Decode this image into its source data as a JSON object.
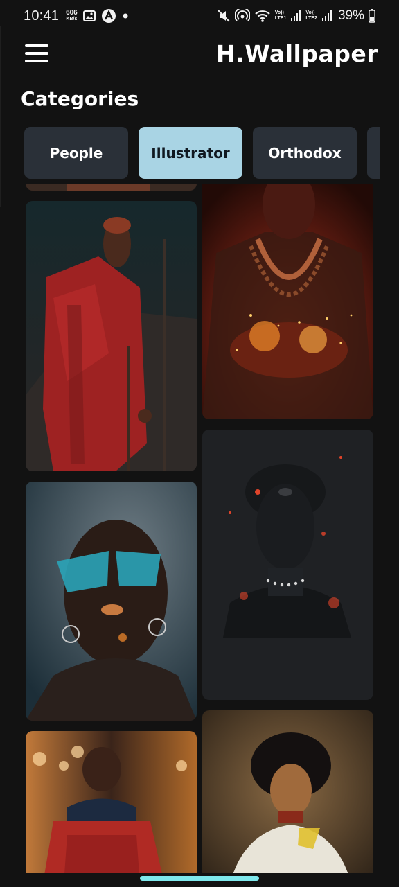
{
  "status_bar": {
    "time": "10:41",
    "net_speed_value": "606",
    "net_speed_unit": "KB/s",
    "lte1": "LTE1",
    "lte2": "LTE2",
    "volte": "Vo))",
    "battery": "39%"
  },
  "app_bar": {
    "title": "H.Wallpaper"
  },
  "categories": {
    "heading": "Categories",
    "chips": [
      {
        "label": "People",
        "selected": false
      },
      {
        "label": "Illustrator",
        "selected": true
      },
      {
        "label": "Orthodox",
        "selected": false
      },
      {
        "label": "",
        "selected": false
      }
    ]
  },
  "wallpapers": [
    {
      "subject": "maasai-warrior-red-shuka-spear"
    },
    {
      "subject": "man-with-glowing-embers-in-hands"
    },
    {
      "subject": "woman-with-tinted-sunglasses"
    },
    {
      "subject": "dark-sculpted-woman-bust"
    },
    {
      "subject": "child-in-red-blanket"
    },
    {
      "subject": "woman-with-afro-illustration"
    }
  ],
  "colors": {
    "background": "#121212",
    "chip": "#2a3038",
    "chip_selected": "#a9d4e4",
    "home_indicator": "#7ee8ec"
  }
}
